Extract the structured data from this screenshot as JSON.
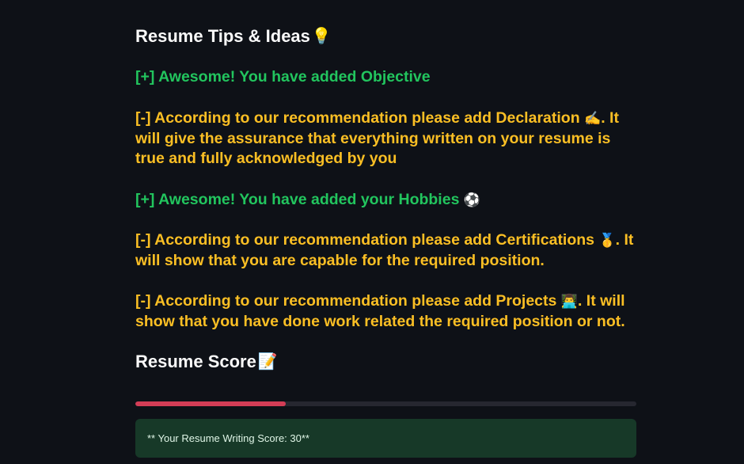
{
  "tips": {
    "heading": "Resume Tips & Ideas",
    "heading_icon": "💡",
    "items": [
      {
        "type": "good",
        "text": "[+] Awesome! You have added Objective",
        "icon": "",
        "suffix": ""
      },
      {
        "type": "warn",
        "text": "[-] According to our recommendation please add Declaration",
        "icon": "✍️",
        "suffix": ". It will give the assurance that everything written on your resume is true and fully acknowledged by you"
      },
      {
        "type": "good",
        "text": "[+] Awesome! You have added your Hobbies",
        "icon": "⚽",
        "suffix": ""
      },
      {
        "type": "warn",
        "text": "[-] According to our recommendation please add Certifications",
        "icon": "🥇",
        "suffix": ". It will show that you are capable for the required position."
      },
      {
        "type": "warn",
        "text": "[-] According to our recommendation please add Projects",
        "icon": "👨‍💻",
        "suffix": ". It will show that you have done work related the required position or not."
      }
    ]
  },
  "score": {
    "heading": "Resume Score",
    "heading_icon": "📝",
    "progress_fraction": 0.3,
    "message": "** Your Resume Writing Score: 30**"
  },
  "colors": {
    "background": "#0e1117",
    "good": "#22c55e",
    "warn": "#fbbf24",
    "progress_fill": "#d33d56",
    "progress_track": "#262730",
    "success_bg": "#173928"
  }
}
